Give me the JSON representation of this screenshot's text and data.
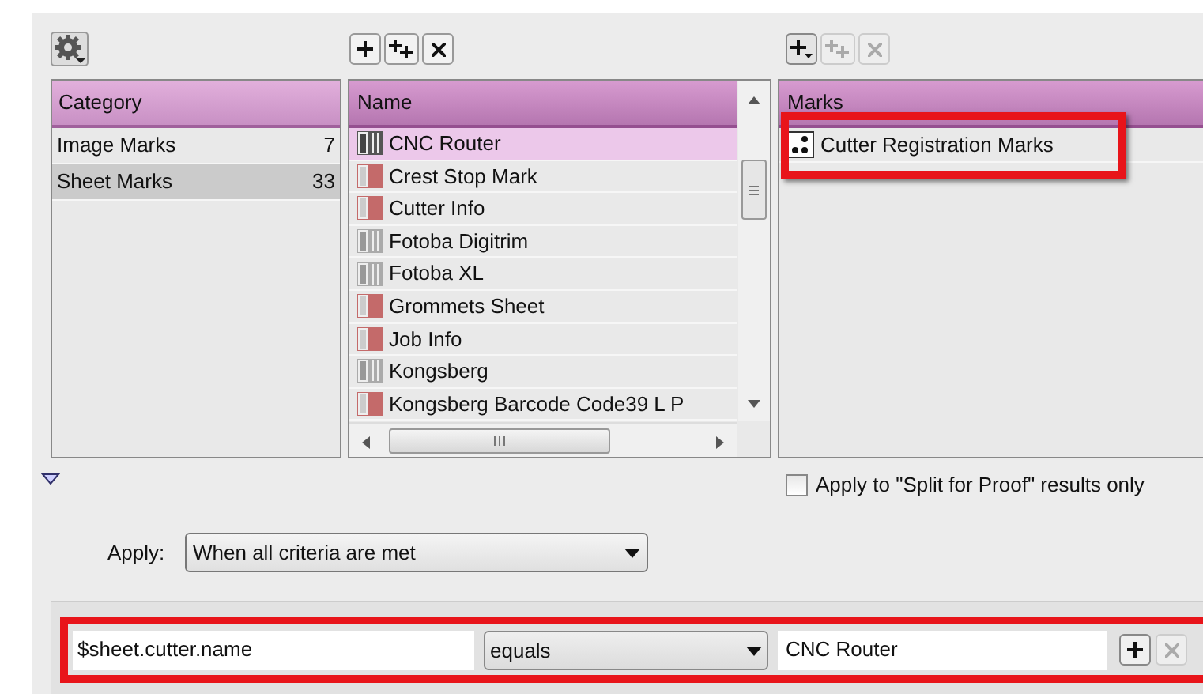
{
  "category_list": {
    "header": "Category",
    "items": [
      {
        "label": "Image Marks",
        "count": "7",
        "selected": false
      },
      {
        "label": "Sheet Marks",
        "count": "33",
        "selected": true
      }
    ]
  },
  "name_list": {
    "header": "Name",
    "items": [
      {
        "label": "CNC Router",
        "kind": "dark",
        "selected": true
      },
      {
        "label": "Crest Stop Mark",
        "kind": "red",
        "selected": false
      },
      {
        "label": "Cutter Info",
        "kind": "red",
        "selected": false
      },
      {
        "label": "Fotoba Digitrim",
        "kind": "gray",
        "selected": false
      },
      {
        "label": "Fotoba XL",
        "kind": "gray",
        "selected": false
      },
      {
        "label": "Grommets Sheet",
        "kind": "red",
        "selected": false
      },
      {
        "label": "Job Info",
        "kind": "red",
        "selected": false
      },
      {
        "label": "Kongsberg",
        "kind": "gray",
        "selected": false
      },
      {
        "label": "Kongsberg Barcode Code39 L P",
        "kind": "red",
        "selected": false
      }
    ]
  },
  "marks_list": {
    "header": "Marks",
    "items": [
      {
        "label": "Cutter Registration Marks"
      }
    ]
  },
  "split_for_proof": {
    "label": "Apply to \"Split for Proof\" results only",
    "checked": false
  },
  "apply": {
    "label": "Apply:",
    "value": "When all criteria are met"
  },
  "criterion": {
    "field": "$sheet.cutter.name",
    "operator": "equals",
    "value": "CNC Router",
    "remove_disabled": true
  }
}
